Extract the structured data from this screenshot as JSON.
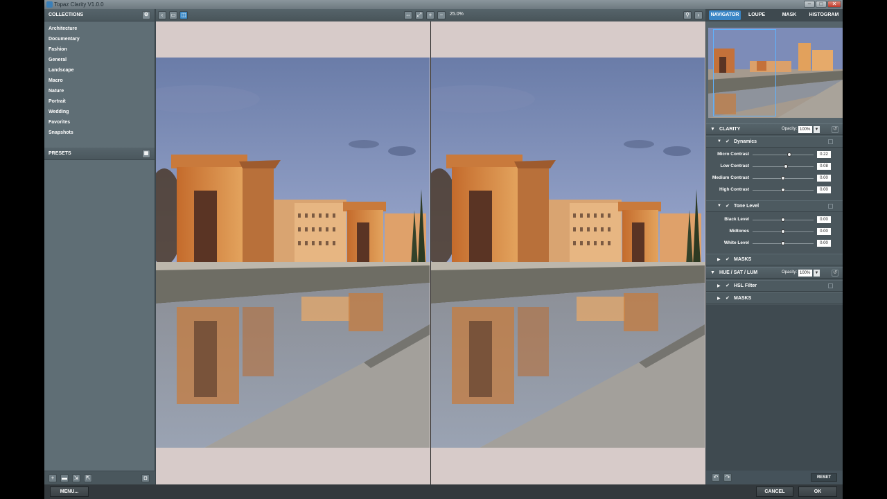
{
  "window": {
    "title": "Topaz Clarity V1.0.0"
  },
  "left_panel": {
    "collections_header": "COLLECTIONS",
    "collections": [
      "Architecture",
      "Documentary",
      "Fashion",
      "General",
      "Landscape",
      "Macro",
      "Nature",
      "Portrait",
      "Wedding",
      "Favorites",
      "Snapshots"
    ],
    "presets_header": "PRESETS"
  },
  "toolbar": {
    "zoom_level": "25.0%"
  },
  "right_panel": {
    "tabs": [
      "NAVIGATOR",
      "LOUPE",
      "MASK",
      "HISTOGRAM"
    ],
    "active_tab": "NAVIGATOR",
    "clarity": {
      "title": "CLARITY",
      "opacity_label": "Opacity:",
      "opacity_value": "100%",
      "dynamics": {
        "title": "Dynamics",
        "sliders": [
          {
            "label": "Micro Contrast",
            "value": "0.22",
            "level": 0.6
          },
          {
            "label": "Low Contrast",
            "value": "0.08",
            "level": 0.54
          },
          {
            "label": "Medium Contrast",
            "value": "0.00",
            "level": 0.5
          },
          {
            "label": "High Contrast",
            "value": "0.00",
            "level": 0.5
          }
        ]
      },
      "tone_level": {
        "title": "Tone Level",
        "sliders": [
          {
            "label": "Black Level",
            "value": "0.00",
            "level": 0.5
          },
          {
            "label": "Midtones",
            "value": "0.00",
            "level": 0.5
          },
          {
            "label": "White Level",
            "value": "0.00",
            "level": 0.5
          }
        ]
      },
      "masks_label": "MASKS"
    },
    "hsl": {
      "title": "HUE / SAT / LUM",
      "opacity_label": "Opacity:",
      "opacity_value": "100%",
      "filter_label": "HSL Filter",
      "masks_label": "MASKS"
    },
    "reset_label": "RESET"
  },
  "bottom_bar": {
    "menu_label": "MENU...",
    "cancel_label": "CANCEL",
    "ok_label": "OK"
  },
  "colors": {
    "accent": "#3a86c6",
    "panel": "#5f6e75",
    "dark_panel": "#4a565c",
    "canvas_bg": "#d7cbc9"
  }
}
